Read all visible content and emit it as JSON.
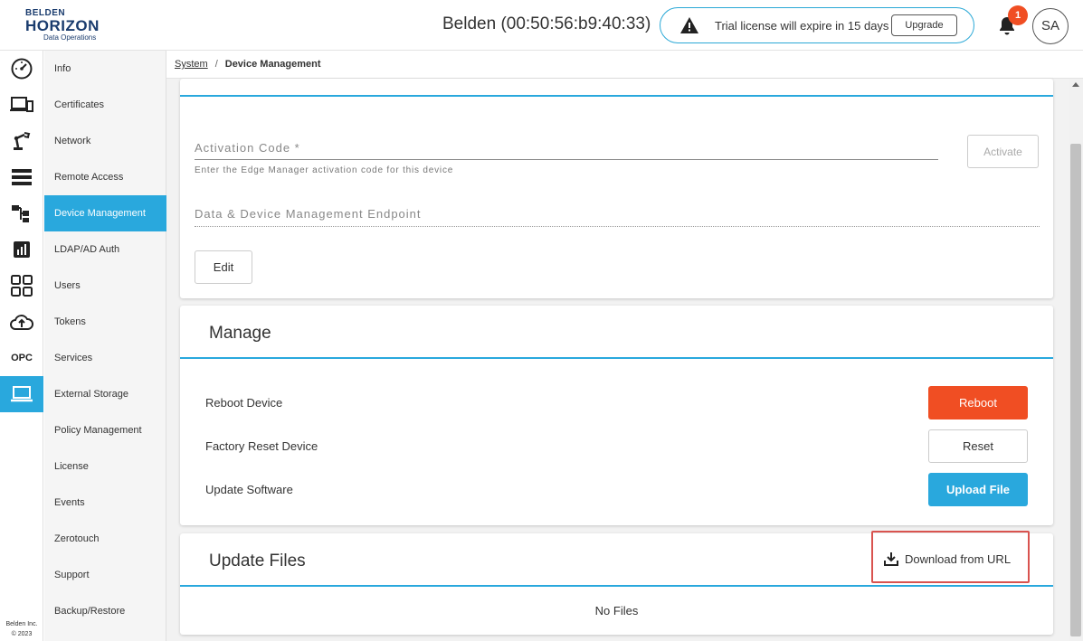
{
  "header": {
    "logo": {
      "line1": "BELDEN",
      "line2": "HORIZON",
      "line3": "Data Operations"
    },
    "device_title": "Belden (00:50:56:b9:40:33)",
    "trial_message": "Trial license will expire in 15 days",
    "upgrade_label": "Upgrade",
    "notification_count": "1",
    "avatar_initials": "SA"
  },
  "rail": {
    "items": [
      {
        "icon": "dashboard-gauge-icon"
      },
      {
        "icon": "devices-icon"
      },
      {
        "icon": "robot-arm-icon"
      },
      {
        "icon": "list-icon"
      },
      {
        "icon": "flow-icon"
      },
      {
        "icon": "analytics-icon"
      },
      {
        "icon": "apps-grid-icon"
      },
      {
        "icon": "cloud-upload-icon"
      },
      {
        "label": "OPC"
      },
      {
        "icon": "laptop-icon",
        "active": true
      }
    ],
    "footer_line1": "Belden Inc.",
    "footer_line2": "© 2023"
  },
  "subnav": {
    "items": [
      {
        "label": "Info"
      },
      {
        "label": "Certificates"
      },
      {
        "label": "Network"
      },
      {
        "label": "Remote Access"
      },
      {
        "label": "Device Management",
        "active": true
      },
      {
        "label": "LDAP/AD Auth"
      },
      {
        "label": "Users"
      },
      {
        "label": "Tokens"
      },
      {
        "label": "Services"
      },
      {
        "label": "External Storage"
      },
      {
        "label": "Policy Management"
      },
      {
        "label": "License"
      },
      {
        "label": "Events"
      },
      {
        "label": "Zerotouch"
      },
      {
        "label": "Support"
      },
      {
        "label": "Backup/Restore"
      }
    ]
  },
  "breadcrumb": {
    "parent": "System",
    "current": "Device Management"
  },
  "activation": {
    "code_label": "Activation Code *",
    "code_hint": "Enter the Edge Manager activation code for this device",
    "activate_label": "Activate",
    "endpoint_label": "Data & Device Management Endpoint",
    "edit_label": "Edit"
  },
  "manage": {
    "title": "Manage",
    "rows": [
      {
        "label": "Reboot Device",
        "button": "Reboot"
      },
      {
        "label": "Factory Reset Device",
        "button": "Reset"
      },
      {
        "label": "Update Software",
        "button": "Upload File"
      }
    ]
  },
  "update_files": {
    "title": "Update Files",
    "download_label": "Download from URL",
    "empty_text": "No Files"
  },
  "colors": {
    "accent": "#29a8dd",
    "danger": "#f04e23",
    "highlight": "#d9534f"
  }
}
